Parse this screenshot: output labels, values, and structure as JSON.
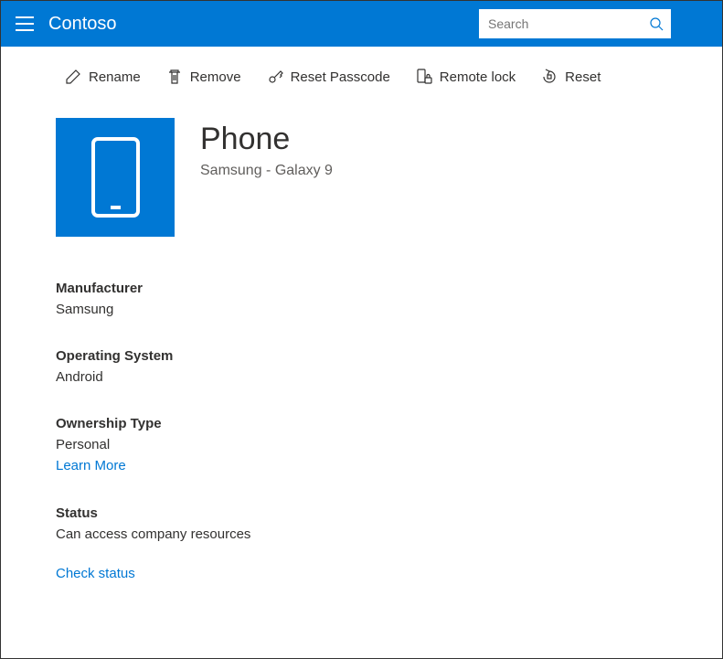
{
  "header": {
    "brand": "Contoso",
    "search_placeholder": "Search"
  },
  "toolbar": {
    "rename": "Rename",
    "remove": "Remove",
    "reset_passcode": "Reset Passcode",
    "remote_lock": "Remote lock",
    "reset": "Reset"
  },
  "device": {
    "title": "Phone",
    "subtitle": "Samsung - Galaxy 9"
  },
  "details": {
    "manufacturer": {
      "label": "Manufacturer",
      "value": "Samsung"
    },
    "os": {
      "label": "Operating System",
      "value": "Android"
    },
    "ownership": {
      "label": "Ownership Type",
      "value": "Personal",
      "learn_more": "Learn More"
    },
    "status": {
      "label": "Status",
      "value": "Can access company resources",
      "check_status": "Check status"
    }
  }
}
